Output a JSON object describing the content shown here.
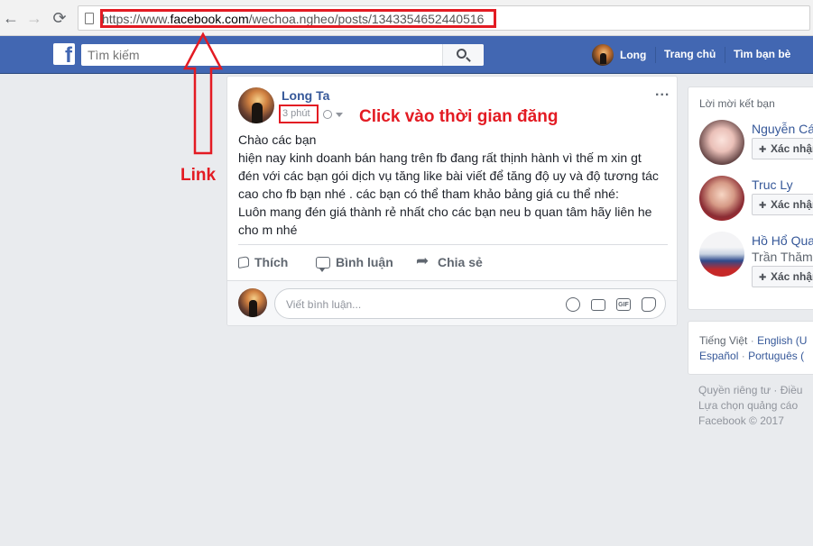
{
  "browser": {
    "back_icon": "←",
    "forward_icon": "→",
    "reload_icon": "⟳",
    "url_prefix": "https://www.",
    "url_domain": "facebook.com",
    "url_path": "/wechoa.ngheo/posts/1343354652440516"
  },
  "topbar": {
    "logo": "f",
    "search_placeholder": "Tìm kiếm",
    "user_name": "Long",
    "home_label": "Trang chủ",
    "friends_label": "Tìm bạn bè",
    "bar_color": "#4267b2"
  },
  "post": {
    "author": "Long Ta",
    "time": "3 phút",
    "body_lines": [
      "Chào các bạn",
      "hiện nay kinh doanh bán hang trên fb đang rất thịnh hành vì thế m xin gt",
      "đén với các bạn gói dịch vụ tăng like bài viết để tăng độ uy và độ tương tác",
      "cao cho fb bạn nhé . các bạn có thể tham khảo bảng giá cu thể nhé:",
      "Luôn mang đén giá thành rẻ nhất cho các bạn neu b quan tâm hãy liên he",
      "cho m nhé"
    ],
    "actions": {
      "like": "Thích",
      "comment": "Bình luận",
      "share": "Chia sẻ"
    },
    "comment_placeholder": "Viết bình luận...",
    "gif_label": "GIF"
  },
  "annotations": {
    "time_hint": "Click vào thời gian đăng",
    "link_hint": "Link",
    "highlight_color": "#e31b23"
  },
  "sidebar": {
    "title": "Lời mời kết bạn",
    "suggestions": [
      {
        "name": "Nguyễn Cát",
        "action": "Xác nhận"
      },
      {
        "name": "Truc Ly",
        "action": "Xác nhận"
      },
      {
        "name": "Hồ Hổ Quang",
        "sub": "Trần Thăm",
        "action": "Xác nhận"
      }
    ],
    "languages": {
      "current": "Tiếng Việt",
      "l1": "English (U",
      "l2": "Español",
      "l3": "Português ("
    },
    "footer": {
      "line1a": "Quyền riêng tư",
      "line1b": "Điều",
      "line2": "Lựa chọn quảng cáo",
      "line3": "Facebook © 2017"
    }
  }
}
